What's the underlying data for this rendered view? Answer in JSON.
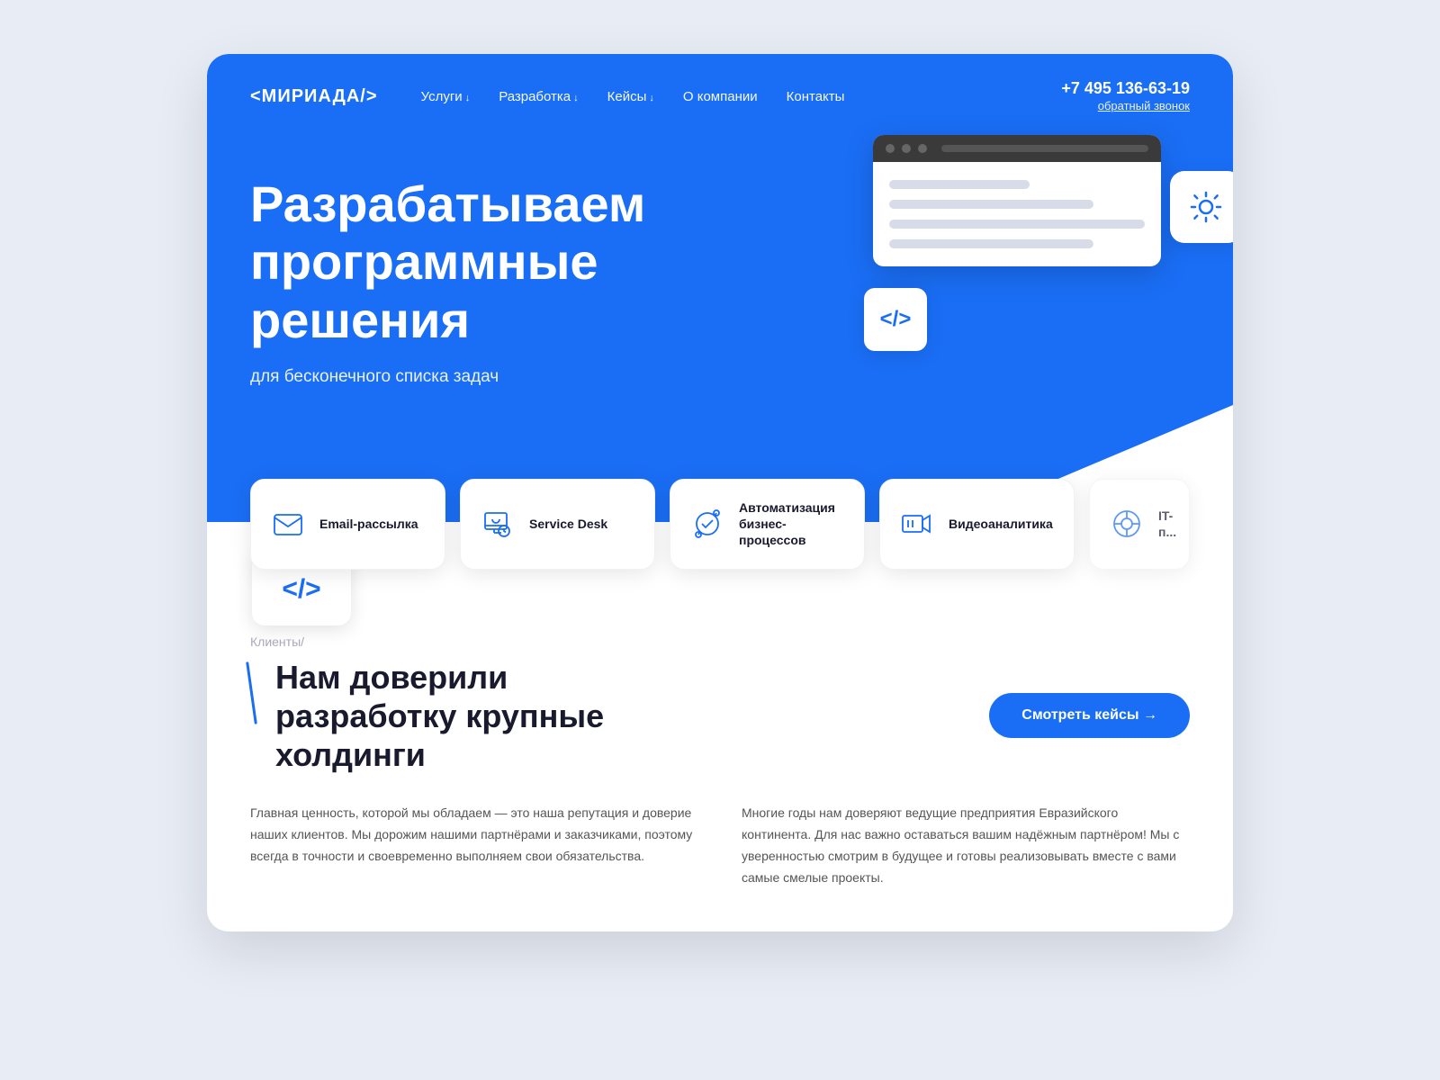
{
  "logo": "<МИРИАДА/>",
  "nav": {
    "links": [
      {
        "label": "Услуги",
        "arrow": true
      },
      {
        "label": "Разработка",
        "arrow": true
      },
      {
        "label": "Кейсы",
        "arrow": true
      },
      {
        "label": "О компании",
        "arrow": false
      },
      {
        "label": "Контакты",
        "arrow": false
      }
    ],
    "phone": "+7 495 136-63-19",
    "callback": "обратный звонок"
  },
  "hero": {
    "title": "Разрабатываем программные решения",
    "subtitle": "для бесконечного списка задач",
    "code_tag_hero": "</>",
    "code_tag_bottom": "</>"
  },
  "services": [
    {
      "id": "email",
      "label": "Email-рассылка",
      "icon": "email"
    },
    {
      "id": "servicedesk",
      "label": "Service Desk",
      "icon": "servicedesk"
    },
    {
      "id": "automation",
      "label": "Автоматизация бизнес-процессов",
      "icon": "automation"
    },
    {
      "id": "video",
      "label": "Видеоаналитика",
      "icon": "video"
    },
    {
      "id": "it",
      "label": "IT-п...",
      "icon": "it"
    }
  ],
  "clients": {
    "section_label": "Клиенты/",
    "title": "Нам доверили разработку крупные холдинги",
    "btn_label": "Смотреть кейсы →",
    "col1": "Главная ценность, которой мы обладаем — это наша репутация и доверие наших клиентов. Мы дорожим нашими партнёрами и заказчиками, поэтому всегда в точности и своевременно выполняем свои обязательства.",
    "col2": "Многие годы нам доверяют ведущие предприятия Евразийского континента. Для нас важно оставаться вашим надёжным партнёром! Мы с уверенностью смотрим в будущее и готовы реализовывать вместе с вами самые смелые проекты."
  }
}
